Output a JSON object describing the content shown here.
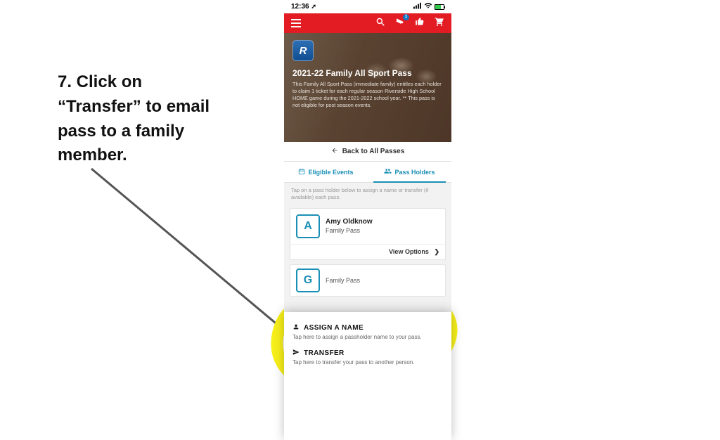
{
  "instruction": {
    "text": "7.  Click on “Transfer” to email pass to a family member."
  },
  "statusBar": {
    "time": "12:36",
    "locArrow": "➚"
  },
  "header": {
    "ticketBadge": "1"
  },
  "hero": {
    "logoLetter": "R",
    "title": "2021-22 Family All Sport Pass",
    "description": "This Family All Sport Pass (immediate family) entitles each holder to claim 1 ticket for each regular season Riverside High School HOME game during the 2021-2022 school year. ** This pass is not eligible for post season events."
  },
  "backBar": {
    "label": "Back to All Passes"
  },
  "tabs": {
    "eligible": "Eligible Events",
    "holders": "Pass Holders"
  },
  "hint": "Tap on a pass holder below to assign a name or transfer (if available) each pass.",
  "holders": [
    {
      "initial": "A",
      "name": "Amy Oldknow",
      "passType": "Family Pass",
      "viewOptions": "View Options",
      "arrow": "❯"
    },
    {
      "initial": "G",
      "name": "",
      "passType": "Family Pass"
    }
  ],
  "sheet": {
    "assign": {
      "title": "ASSIGN A NAME",
      "sub": "Tap here to assign a passholder name to your pass."
    },
    "transfer": {
      "title": "TRANSFER",
      "sub": "Tap here to transfer your pass to another person."
    }
  }
}
